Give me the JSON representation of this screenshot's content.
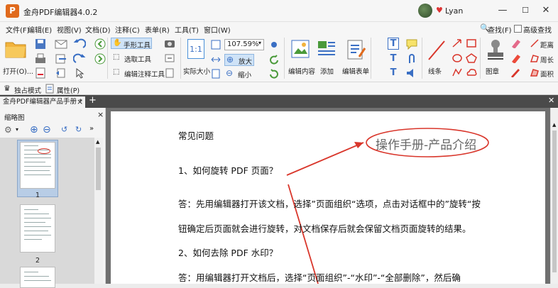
{
  "window": {
    "title": "金舟PDF编辑器4.0.2",
    "user": "Lyan",
    "minimize": "—",
    "restore": "☐",
    "close": "✕"
  },
  "menu": [
    "文件(F)",
    "编辑(E)",
    "视图(V)",
    "文档(D)",
    "注释(C)",
    "表单(R)",
    "工具(T)",
    "窗口(W)"
  ],
  "search": {
    "find": "查找(F)",
    "advanced": "高级查找(S)"
  },
  "ribbon": {
    "open": "打开(O)...",
    "hand_tool": "手形工具",
    "select_tool": "选取工具",
    "edit_annot_tool": "编辑注释工具",
    "actual_size": "实际大小",
    "zoom_value": "107.59%",
    "zoom_in": "放大",
    "zoom_out": "缩小",
    "edit_content": "编辑内容",
    "add": "添加",
    "edit_form": "编辑表单",
    "line": "线条",
    "stamp": "图章",
    "distance": "距离",
    "perimeter": "周长",
    "area": "面积"
  },
  "ribbon2": {
    "standalone": "独占模式",
    "properties": "属性(P)"
  },
  "tab": {
    "label": "金舟PDF编辑器产品手册 *",
    "close": "×",
    "add": "+"
  },
  "sidebar": {
    "title": "缩略图",
    "close": "×",
    "pages": [
      "1",
      "2"
    ]
  },
  "page": {
    "annotation": "操作手册-产品介绍",
    "heading": "常见问题",
    "q1": "1、如何旋转 PDF 页面？",
    "a1_line1": "答：先用编辑器打开该文档，选择”页面组织“选项，点击对话框中的”旋转“按",
    "a1_line2": "钮确定后页面就会进行旋转，对文档保存后就会保留文档页面旋转的结果。",
    "q2": "2、如何去除 PDF 水印？",
    "a2_line1": "答：用编辑器打开文档后，选择“页面组织”-“水印”-“全部删除”，然后确"
  },
  "colors": {
    "accent": "#e06a1c",
    "annotation_red": "#d9362b",
    "tab_bar": "#4a4a4a"
  }
}
